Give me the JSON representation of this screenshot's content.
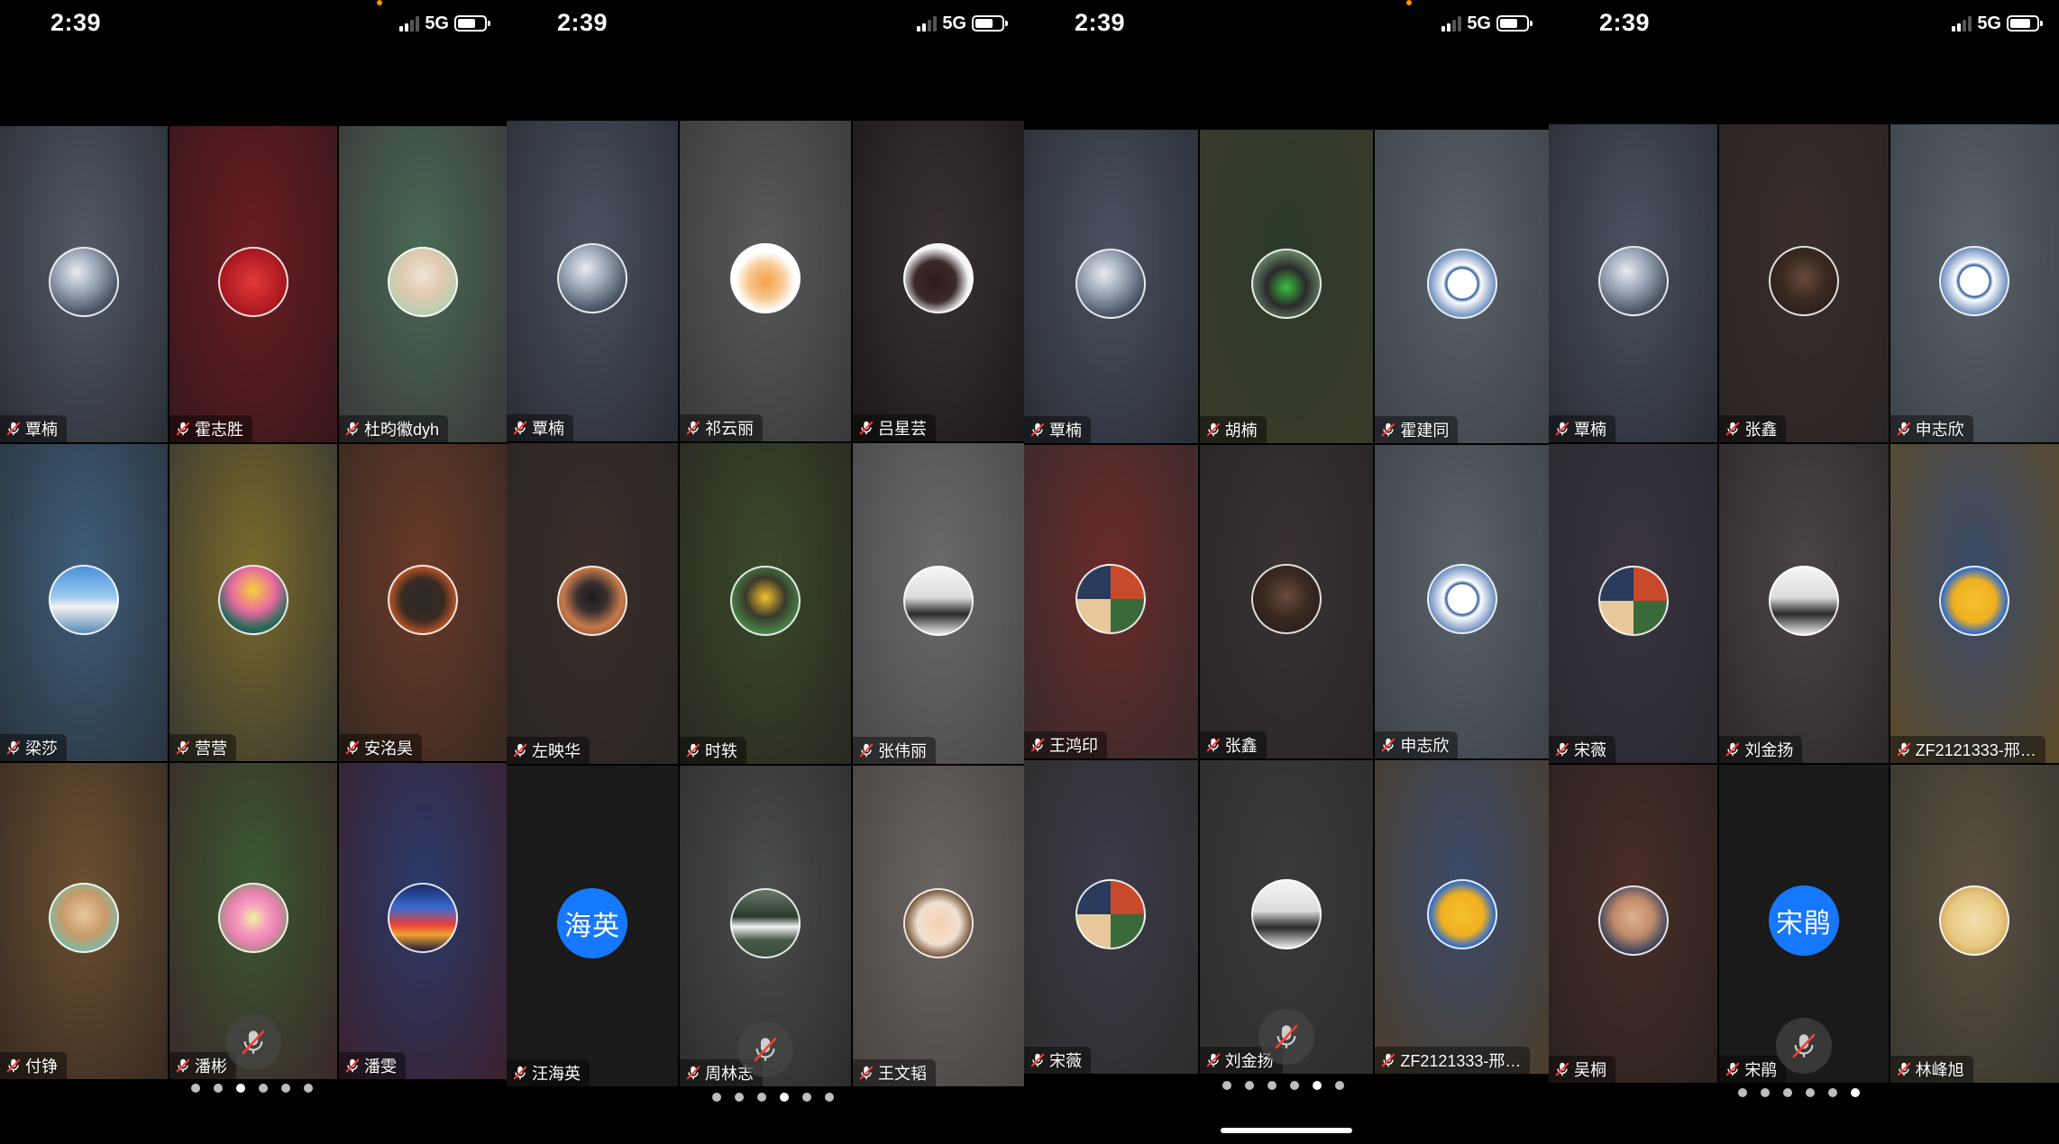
{
  "colors": {
    "accent_blue": "#1677ff",
    "muted_red": "#ff3b30",
    "status_orange": "#ff9500"
  },
  "screens": [
    {
      "time": "2:39",
      "network": "5G",
      "page_dot_active": 3,
      "page_count": 6,
      "participants": [
        {
          "name": "覃楠",
          "avatar": "snow-mountain-avatar",
          "bg": [
            "#525a66",
            "#2c3038"
          ]
        },
        {
          "name": "霍志胜",
          "avatar": "red-badge-avatar",
          "bg": [
            "#6b1d24",
            "#38171a"
          ]
        },
        {
          "name": "杜昀徽dyh",
          "avatar": "portrait-avatar",
          "bg": [
            "#4a6a55",
            "#3a3a3a"
          ]
        },
        {
          "name": "梁莎",
          "avatar": "beach-pavilion-avatar",
          "bg": [
            "#3e5d7a",
            "#2b3640"
          ]
        },
        {
          "name": "营营",
          "avatar": "flower-pot-avatar",
          "bg": [
            "#7a6a2a",
            "#3a3a30"
          ]
        },
        {
          "name": "安洺昊",
          "avatar": "cat-avatar",
          "bg": [
            "#6a3a28",
            "#3a2a22"
          ]
        },
        {
          "name": "付铮",
          "avatar": "kitten-avatar",
          "bg": [
            "#6b5030",
            "#3a2c22"
          ]
        },
        {
          "name": "潘彬",
          "avatar": "lotus-avatar",
          "bg": [
            "#3a5a30",
            "#3a2a2a"
          ]
        },
        {
          "name": "潘雯",
          "avatar": "city-night-avatar",
          "bg": [
            "#2a3a6a",
            "#3a2230"
          ]
        }
      ]
    },
    {
      "time": "2:39",
      "network": "5G",
      "page_dot_active": 4,
      "page_count": 6,
      "participants": [
        {
          "name": "覃楠",
          "avatar": "snow-mountain-avatar",
          "bg": [
            "#4a5260",
            "#2a2e36"
          ]
        },
        {
          "name": "祁云丽",
          "avatar": "corgi-avatar",
          "bg": [
            "#5a5a5a",
            "#3a3a3a"
          ]
        },
        {
          "name": "吕星芸",
          "avatar": "woman-silhouette-avatar",
          "bg": [
            "#3a3232",
            "#1e1a1a"
          ]
        },
        {
          "name": "左映华",
          "avatar": "robot-avatar",
          "bg": [
            "#3a2e2a",
            "#2a2624"
          ]
        },
        {
          "name": "时轶",
          "avatar": "cartoon-boy-avatar",
          "bg": [
            "#3a4a2a",
            "#2a2a22"
          ]
        },
        {
          "name": "张伟丽",
          "avatar": "sunset-sea-avatar",
          "bg": [
            "#6a6a6a",
            "#4a4a4a"
          ]
        },
        {
          "name": "汪海英",
          "avatar_text": "海英",
          "bg": [
            "#1a1a1a",
            "#1a1a1a"
          ]
        },
        {
          "name": "周林志",
          "avatar": "waterfall-avatar",
          "bg": [
            "#4a4e4a",
            "#2e2e2e"
          ]
        },
        {
          "name": "王文韬",
          "avatar": "anime-boy-avatar",
          "bg": [
            "#6a6462",
            "#4a4442"
          ]
        }
      ]
    },
    {
      "time": "2:39",
      "network": "5G",
      "page_dot_active": 5,
      "page_count": 6,
      "participants": [
        {
          "name": "覃楠",
          "avatar": "snow-mountain-avatar",
          "bg": [
            "#4a5260",
            "#2a2e36"
          ]
        },
        {
          "name": "胡楠",
          "avatar": "rider-avatar",
          "bg": [
            "#2a3a2a",
            "#3a3a2a"
          ]
        },
        {
          "name": "霍建同",
          "avatar": "school-logo-avatar",
          "bg": [
            "#5a626a",
            "#3e444a"
          ]
        },
        {
          "name": "王鸿印",
          "avatar": "collage-avatar",
          "bg": [
            "#6a2a2a",
            "#3a2a2a"
          ]
        },
        {
          "name": "张鑫",
          "avatar": "dark-hair-avatar",
          "bg": [
            "#3a3232",
            "#2a2626"
          ]
        },
        {
          "name": "申志欣",
          "avatar": "school-logo-avatar",
          "bg": [
            "#5a626a",
            "#3e444a"
          ]
        },
        {
          "name": "宋薇",
          "avatar": "collage-avatar",
          "bg": [
            "#3a3a4a",
            "#2e2e2e"
          ]
        },
        {
          "name": "刘金扬",
          "avatar": "sunset-sea-avatar",
          "bg": [
            "#3a3a3a",
            "#2e2e2e"
          ]
        },
        {
          "name": "ZF2121333-邢…",
          "avatar": "worker-emoji-avatar",
          "bg": [
            "#3a4a6a",
            "#4a3e2e"
          ]
        }
      ]
    },
    {
      "time": "2:39",
      "network": "5G",
      "page_dot_active": 6,
      "page_count": 6,
      "participants": [
        {
          "name": "覃楠",
          "avatar": "snow-mountain-avatar",
          "bg": [
            "#4a5260",
            "#2a2e36"
          ]
        },
        {
          "name": "张鑫",
          "avatar": "dark-hair-avatar",
          "bg": [
            "#3a2e2a",
            "#2a2424"
          ]
        },
        {
          "name": "申志欣",
          "avatar": "school-logo-avatar",
          "bg": [
            "#5a626a",
            "#3e444a"
          ]
        },
        {
          "name": "宋薇",
          "avatar": "collage-avatar",
          "bg": [
            "#3a3440",
            "#2a2a30"
          ]
        },
        {
          "name": "刘金扬",
          "avatar": "sunset-sea-avatar",
          "bg": [
            "#4a4446",
            "#2e2a2a"
          ]
        },
        {
          "name": "ZF2121333-邢…",
          "avatar": "worker-emoji-avatar",
          "bg": [
            "#3a4a6a",
            "#5a4a2a"
          ]
        },
        {
          "name": "吴桐",
          "avatar": "man-portrait-avatar",
          "bg": [
            "#4a2e28",
            "#2a2220"
          ]
        },
        {
          "name": "宋鹃",
          "avatar_text": "宋鹃",
          "bg": [
            "#1a1a1a",
            "#1a1a1a"
          ]
        },
        {
          "name": "林峰旭",
          "avatar": "toast-avatar",
          "bg": [
            "#5a5040",
            "#3a3830"
          ]
        }
      ]
    }
  ]
}
